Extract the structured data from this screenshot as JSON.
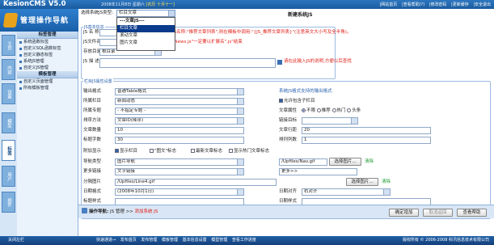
{
  "header": {
    "app_title": "KesionCMS V5.0",
    "date_prefix": "2008年11月8日 星期六 ",
    "lunar": "[农历 十月十一]",
    "links": [
      "|网站首页",
      "|查看帮助(?)",
      "|修改密码",
      "|更新缓存",
      "|安全退出"
    ]
  },
  "logo": {
    "text": "管理操作导航"
  },
  "vtabs": [
    "主页",
    "内容",
    "设置",
    "模型",
    "标签",
    "用户",
    "插件"
  ],
  "vtabs_active": 4,
  "sidebar": {
    "section1": "标签管理",
    "items1": [
      "系统函数标签",
      "自定义SQL函数标签",
      "自定义静态标签",
      "系统JS管理",
      "自定义JS管理"
    ],
    "section2": "模板管理",
    "items2": [
      "自定义页面管理",
      "所有模板管理"
    ]
  },
  "main": {
    "type_label": "选择系统JS类型:",
    "type_value": "栏目文章",
    "page_title": "新建系统JS",
    "dropdown": [
      "---文章JS---",
      "栏目文章",
      "滚动文章",
      "图片文章"
    ],
    "dropdown_selected": 1,
    "fs1_legend": "JS基本信息",
    "js_name_label": "JS 名 称",
    "js_name_value": "",
    "js_name_hint": "例如JS名称:\"推荐文章列表\",则在模板中调用:\"{JS_推荐文章列表}\"(注意英文大小写及全半角)。",
    "js_file_label": "JS文件名",
    "js_file_value": "",
    "js_file_hint": "例如\"News.js\"一定要以扩展名\".js\"结束",
    "save_dir_label": "存放目录",
    "save_dir_value": "根目录",
    "desc_label": "JS 描 述",
    "desc_hint": "请在此输入JS的说明,方便以后查找",
    "fs2_legend": "栏目JS属性设置",
    "form": {
      "output_format_label": "输出格式",
      "output_format": "普通Table格式",
      "column_label": "所属栏目",
      "column": "新闻动态",
      "special_label": "所属专题",
      "special": "- 不指定专题 -",
      "sort_label": "排序方法",
      "sort": "文章ID(降序)",
      "count_label": "文章数量",
      "count": "10",
      "title_chars_label": "标题字数",
      "title_chars": "30",
      "attach_label": "附加显示",
      "attach_opts": [
        "显示栏目",
        "\"图文\"标志",
        "最新文章标志",
        "显示热门文章标志"
      ],
      "nav_label": "导航类型",
      "nav_type": "图片导航",
      "nav_path": "/Upfiles/Nav.gif",
      "select_image": "选择图片...",
      "clear": "清除",
      "more_label": "更多链接",
      "more_type": "文字链接",
      "more_text": "更多>>",
      "sep_label": "分隔图片",
      "sep_path": "/Upfiles/Line4.gif",
      "date_format_label": "日期格式",
      "date_format": "(2008年10月1日)",
      "date_align_label": "日期对齐",
      "date_align": "右对齐",
      "title_style_label": "标题样式",
      "date_style_label": "日期样式",
      "right_header": "系统JS格式支持的输出格式",
      "allow_sub": "允许包含子栏目",
      "article_attr_label": "文章属性",
      "article_attrs": [
        "不限",
        "推荐",
        "热门",
        "头条"
      ],
      "link_target_label": "链接目标",
      "row_spacing_label": "文章行距",
      "row_spacing": "20",
      "columns_label": "排列列数",
      "columns": "1"
    },
    "crumb_label": "操作导航:",
    "crumb_sys": "JS 管理",
    "crumb_add": "添加系统 JS",
    "btn_ok": "确定增加",
    "btn_back": "取消返回",
    "btn_view": "查看帮助"
  },
  "status": {
    "logout": "关闭左栏",
    "quick": [
      "快速通道→",
      "发布首页",
      "发布管理",
      "模板管理",
      "基本信息设置",
      "模型管理",
      "查看工作进度"
    ],
    "copyright": "版权所有 © 2006-2008 科汛信息技术有限公司"
  }
}
